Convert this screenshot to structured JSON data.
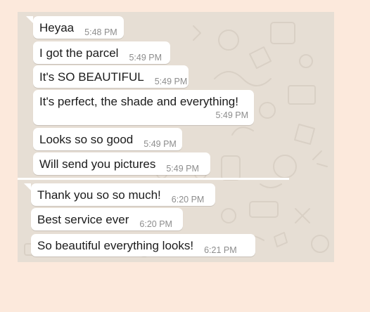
{
  "messages": [
    {
      "text": "Heyaa",
      "time": "5:48 PM"
    },
    {
      "text": "I got the parcel",
      "time": "5:49 PM"
    },
    {
      "text": "It's SO BEAUTIFUL",
      "time": "5:49 PM"
    },
    {
      "text": "It's perfect, the shade and everything!",
      "time": "5:49 PM"
    },
    {
      "text": "Looks so so good",
      "time": "5:49 PM"
    },
    {
      "text": "Will send you pictures",
      "time": "5:49 PM"
    },
    {
      "text": "Thank you so so much!",
      "time": "6:20 PM"
    },
    {
      "text": "Best service ever",
      "time": "6:20 PM"
    },
    {
      "text": "So beautiful everything looks!",
      "time": "6:21 PM"
    }
  ],
  "colors": {
    "page_background": "#fce9dc",
    "chat_wallpaper": "#e6ded4",
    "bubble": "#ffffff",
    "message_text": "#1b1b1b",
    "timestamp_text": "#8d8d8d"
  },
  "icons": [
    "wallpaper-doodle-icons"
  ]
}
